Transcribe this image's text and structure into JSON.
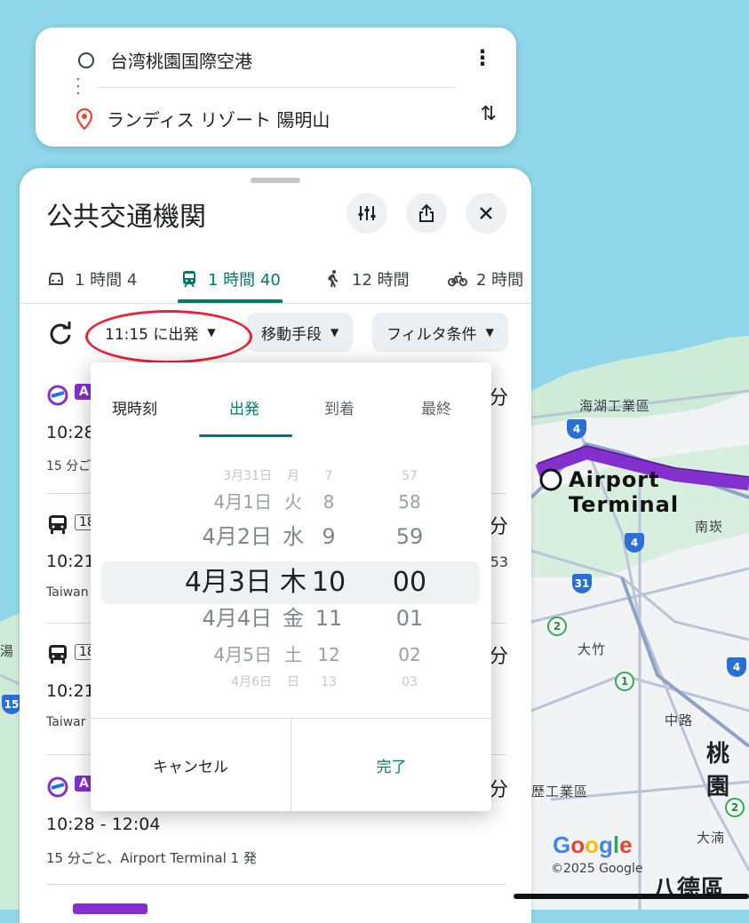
{
  "route": {
    "origin": "台湾桃園国際空港",
    "destination": "ランディス リゾート 陽明山"
  },
  "sheet": {
    "title": "公共交通機関",
    "mode_tabs": [
      {
        "label": "1 時間 4",
        "icon": "car-icon"
      },
      {
        "label": "1 時間 40",
        "icon": "train-icon",
        "active": true
      },
      {
        "label": "12 時間",
        "icon": "walk-icon"
      },
      {
        "label": "2 時間",
        "icon": "bike-icon"
      }
    ],
    "filters": {
      "depart": "11:15 に出発",
      "modes": "移動手段",
      "conditions": "フィルタ条件"
    }
  },
  "results": [
    {
      "badge": "A",
      "time": "10:28",
      "sub": "15 分ご",
      "dur": "分"
    },
    {
      "badge": "18",
      "time": "10:21",
      "sub": "Taiwan",
      "dur": "分",
      "extra": "53"
    },
    {
      "badge": "18",
      "time": "10:21",
      "sub": "Taiwar",
      "dur": "分"
    },
    {
      "badge": "A",
      "time": "10:28 - 12:04",
      "sub": "15 分ごと、Airport Terminal 1 発",
      "dur": "分"
    }
  ],
  "picker": {
    "tabs": [
      "現時刻",
      "出発",
      "到着",
      "最終"
    ],
    "active_tab": "出発",
    "rows": [
      {
        "date": "3月31日",
        "wd": "月",
        "hr": "7",
        "min": "57"
      },
      {
        "date": "4月1日",
        "wd": "火",
        "hr": "8",
        "min": "58"
      },
      {
        "date": "4月2日",
        "wd": "水",
        "hr": "9",
        "min": "59"
      },
      {
        "date": "4月3日",
        "wd": "木",
        "hr": "10",
        "min": "00"
      },
      {
        "date": "4月4日",
        "wd": "金",
        "hr": "11",
        "min": "01"
      },
      {
        "date": "4月5日",
        "wd": "土",
        "hr": "12",
        "min": "02"
      },
      {
        "date": "4月6日",
        "wd": "日",
        "hr": "13",
        "min": "03"
      }
    ],
    "cancel": "キャンセル",
    "done": "完了"
  },
  "map": {
    "labels": {
      "haihu": "海湖工業區",
      "terminal": "Airport Terminal",
      "nankan": "南崁",
      "dazhu": "大竹",
      "zhonglu": "中路",
      "taoyuan": "桃園",
      "industry": "歷工業區",
      "dapu": "大湳",
      "bade": "八德區",
      "pu": "湯"
    },
    "google": [
      "G",
      "o",
      "o",
      "g",
      "l",
      "e"
    ],
    "copyright": "©2025 Google",
    "route_color": "#8430ce",
    "accent": "#00796b"
  }
}
